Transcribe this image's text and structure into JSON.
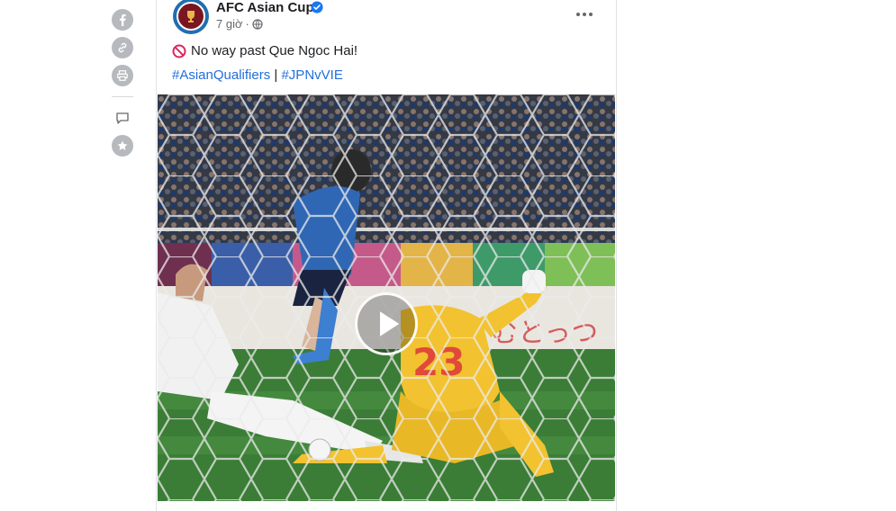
{
  "share_rail": {
    "items": [
      {
        "icon": "facebook-icon"
      },
      {
        "icon": "link-icon"
      },
      {
        "icon": "print-icon"
      },
      {
        "icon": "comment-icon"
      },
      {
        "icon": "star-icon"
      }
    ]
  },
  "post": {
    "page_name": "AFC Asian Cup",
    "verified": true,
    "timestamp": "7 giờ",
    "separator": "·",
    "audience_icon": "globe-icon",
    "text": "No way past Que Ngoc Hai!",
    "text_emoji": "no-entry-icon",
    "hashtags": [
      "#AsianQualifiers",
      "#JPNvVIE"
    ],
    "hashtag_separator": "|",
    "video": {
      "shirt_number": "23",
      "play_icon": "play-icon"
    }
  },
  "colors": {
    "link": "#216fdb",
    "muted": "#65676b",
    "rail_icon_bg": "#b6b9bd",
    "keeper_kit": "#f2c230"
  }
}
